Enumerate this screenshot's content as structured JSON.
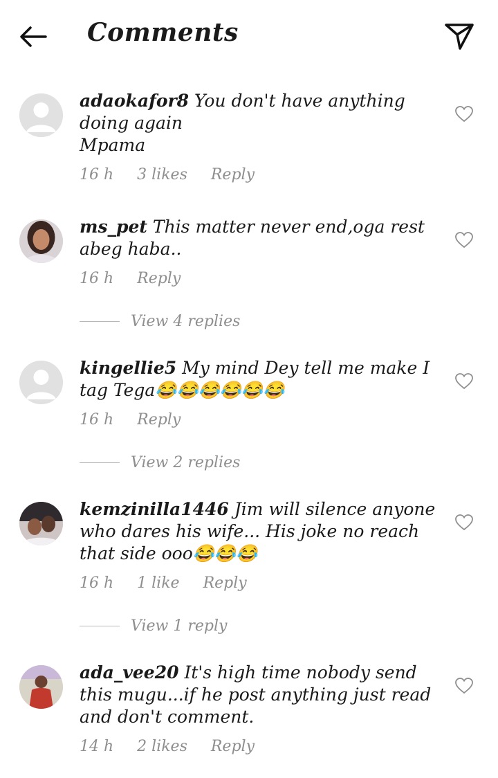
{
  "header": {
    "title": "Comments",
    "back_icon": "arrow-left-icon",
    "share_icon": "paper-plane-icon"
  },
  "comments": [
    {
      "username": "adaokafor8",
      "text": " You don't have anything doing again\nMpama",
      "time": "16 h",
      "likes": "3 likes",
      "reply": "Reply",
      "avatar": "default"
    },
    {
      "username": "ms_pet",
      "text": " This matter never end,oga  rest abeg haba..",
      "time": "16 h",
      "likes": "",
      "reply": "Reply",
      "view_replies": "View 4 replies",
      "avatar": "photo-woman"
    },
    {
      "username": "kingellie5",
      "text": " My mind Dey tell me make I tag Tega😂😂😂😂😂😂",
      "time": "16 h",
      "likes": "",
      "reply": "Reply",
      "view_replies": "View 2 replies",
      "avatar": "default"
    },
    {
      "username": "kemzinilla1446",
      "text": " Jim will silence anyone who dares his wife... His joke no reach that side ooo😂😂😂",
      "time": "16 h",
      "likes": "1 like",
      "reply": "Reply",
      "view_replies": "View 1 reply",
      "avatar": "photo-couple"
    },
    {
      "username": "ada_vee20",
      "text": " It's high time nobody send this mugu...if he post anything just read and don't comment.",
      "time": "14 h",
      "likes": "2 likes",
      "reply": "Reply",
      "avatar": "photo-man"
    }
  ]
}
